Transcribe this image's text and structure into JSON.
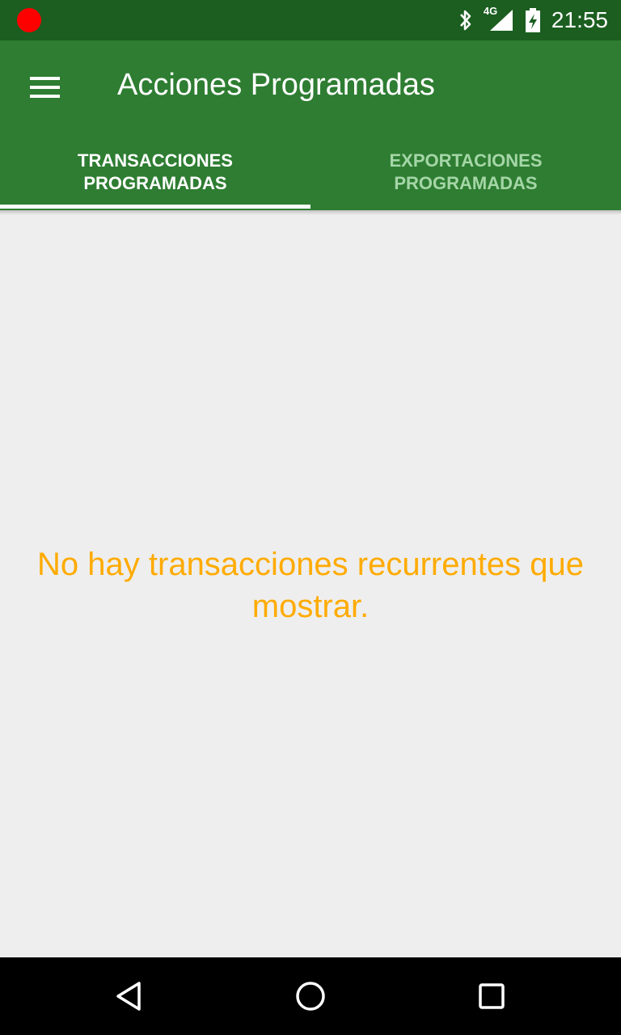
{
  "status_bar": {
    "time": "21:55",
    "network": "4G",
    "icons": [
      "recording-dot",
      "bluetooth-icon",
      "signal-icon",
      "battery-charging-icon"
    ]
  },
  "app_bar": {
    "title": "Acciones Programadas",
    "menu_icon": "hamburger-menu-icon"
  },
  "tabs": [
    {
      "label": "TRANSACCIONES PROGRAMADAS",
      "selected": true
    },
    {
      "label": "EXPORTACIONES PROGRAMADAS",
      "selected": false
    }
  ],
  "content": {
    "empty_message": "No hay transacciones recurrentes que mostrar."
  },
  "nav_bar": {
    "icons": [
      "back-icon",
      "home-icon",
      "recents-icon"
    ]
  },
  "colors": {
    "status_bar": "#1b5e20",
    "app_bar": "#2e7d32",
    "background": "#eeeeee",
    "empty_message": "#ffab00",
    "inactive_tab": "#a5d6a7"
  }
}
